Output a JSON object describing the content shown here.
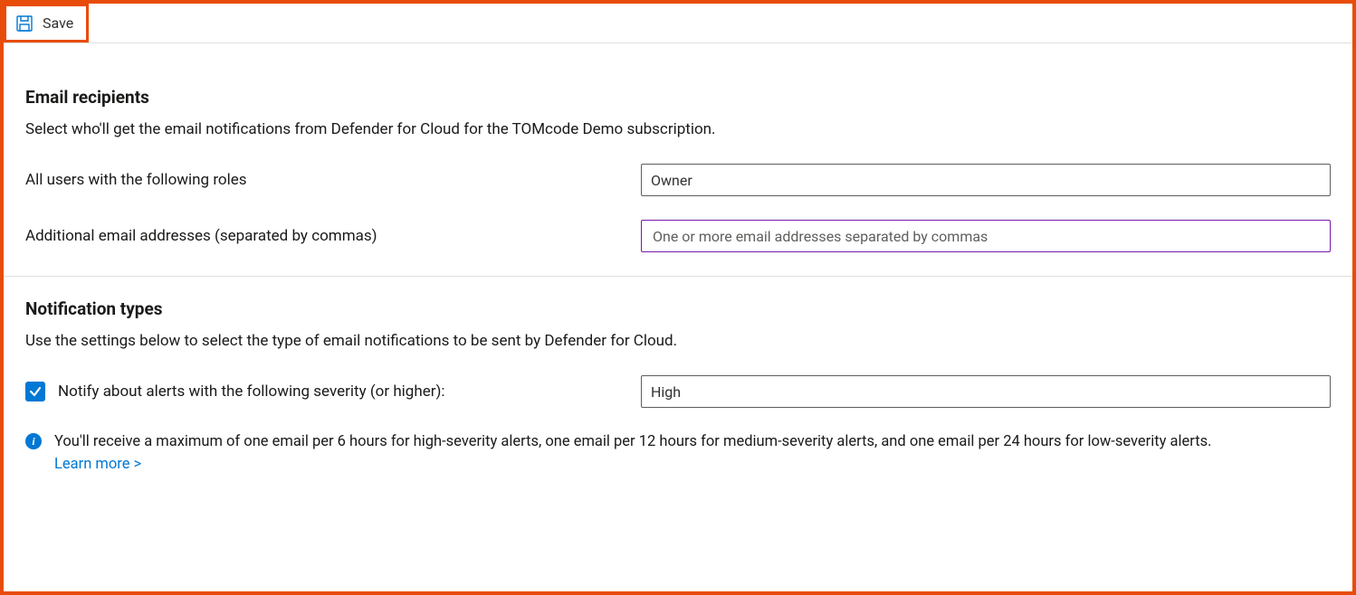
{
  "toolbar": {
    "save_label": "Save"
  },
  "recipients": {
    "title": "Email recipients",
    "description": "Select who'll get the email notifications from Defender for Cloud for the TOMcode Demo subscription.",
    "roles_label": "All users with the following roles",
    "roles_value": "Owner",
    "emails_label": "Additional email addresses (separated by commas)",
    "emails_placeholder": "One or more email addresses separated by commas"
  },
  "notifications": {
    "title": "Notification types",
    "description": "Use the settings below to select the type of email notifications to be sent by Defender for Cloud.",
    "severity_checkbox_checked": true,
    "severity_label": "Notify about alerts with the following severity (or higher):",
    "severity_value": "High",
    "info_text": "You'll receive a maximum of one email per 6 hours for high-severity alerts, one email per 12 hours for medium-severity alerts, and one email per 24 hours for low-severity alerts.",
    "learn_more": "Learn more >"
  },
  "info_glyph": "i"
}
